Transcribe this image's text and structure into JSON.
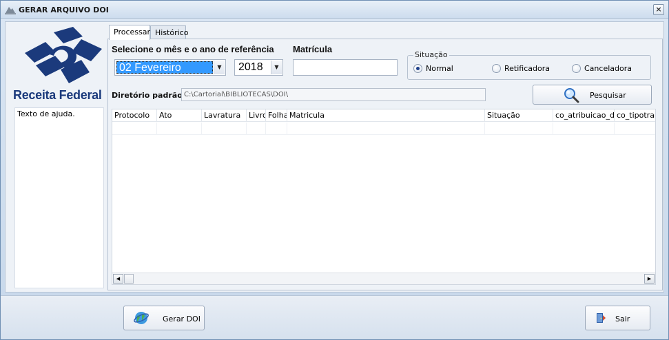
{
  "window": {
    "title": "GERAR ARQUIVO DOI",
    "close_glyph": "×"
  },
  "logo": {
    "text": "Receita Federal",
    "colors": {
      "brand": "#1b3a7c"
    }
  },
  "help": {
    "text": "Texto de ajuda."
  },
  "tabs": [
    {
      "label": "Processar",
      "active": true
    },
    {
      "label": "Histórico",
      "active": false
    }
  ],
  "form": {
    "period_label": "Selecione o mês e o ano de referência",
    "month": {
      "value": "02 Fevereiro"
    },
    "year": {
      "value": "2018"
    },
    "matricula_label": "Matrícula",
    "matricula_value": "",
    "situacao": {
      "legend": "Situação",
      "options": [
        {
          "label": "Normal",
          "selected": true
        },
        {
          "label": "Retificadora",
          "selected": false
        },
        {
          "label": "Canceladora",
          "selected": false
        }
      ]
    },
    "directory_label": "Diretório padrão",
    "directory_value": "C:\\Cartorial\\BIBLIOTECAS\\DOI\\",
    "search_button": {
      "label": "Pesquisar",
      "icon": "magnifier-icon"
    }
  },
  "grid": {
    "columns": [
      "Protocolo",
      "Ato",
      "Lavratura",
      "Livro",
      "Folha",
      "Matricula",
      "Situação",
      "co_atribuicao_doi",
      "co_tipotra"
    ],
    "rows": []
  },
  "actions": {
    "generate": {
      "label": "Gerar DOI",
      "icon": "globe-icon"
    },
    "exit": {
      "label": "Sair",
      "icon": "exit-door-icon"
    }
  }
}
